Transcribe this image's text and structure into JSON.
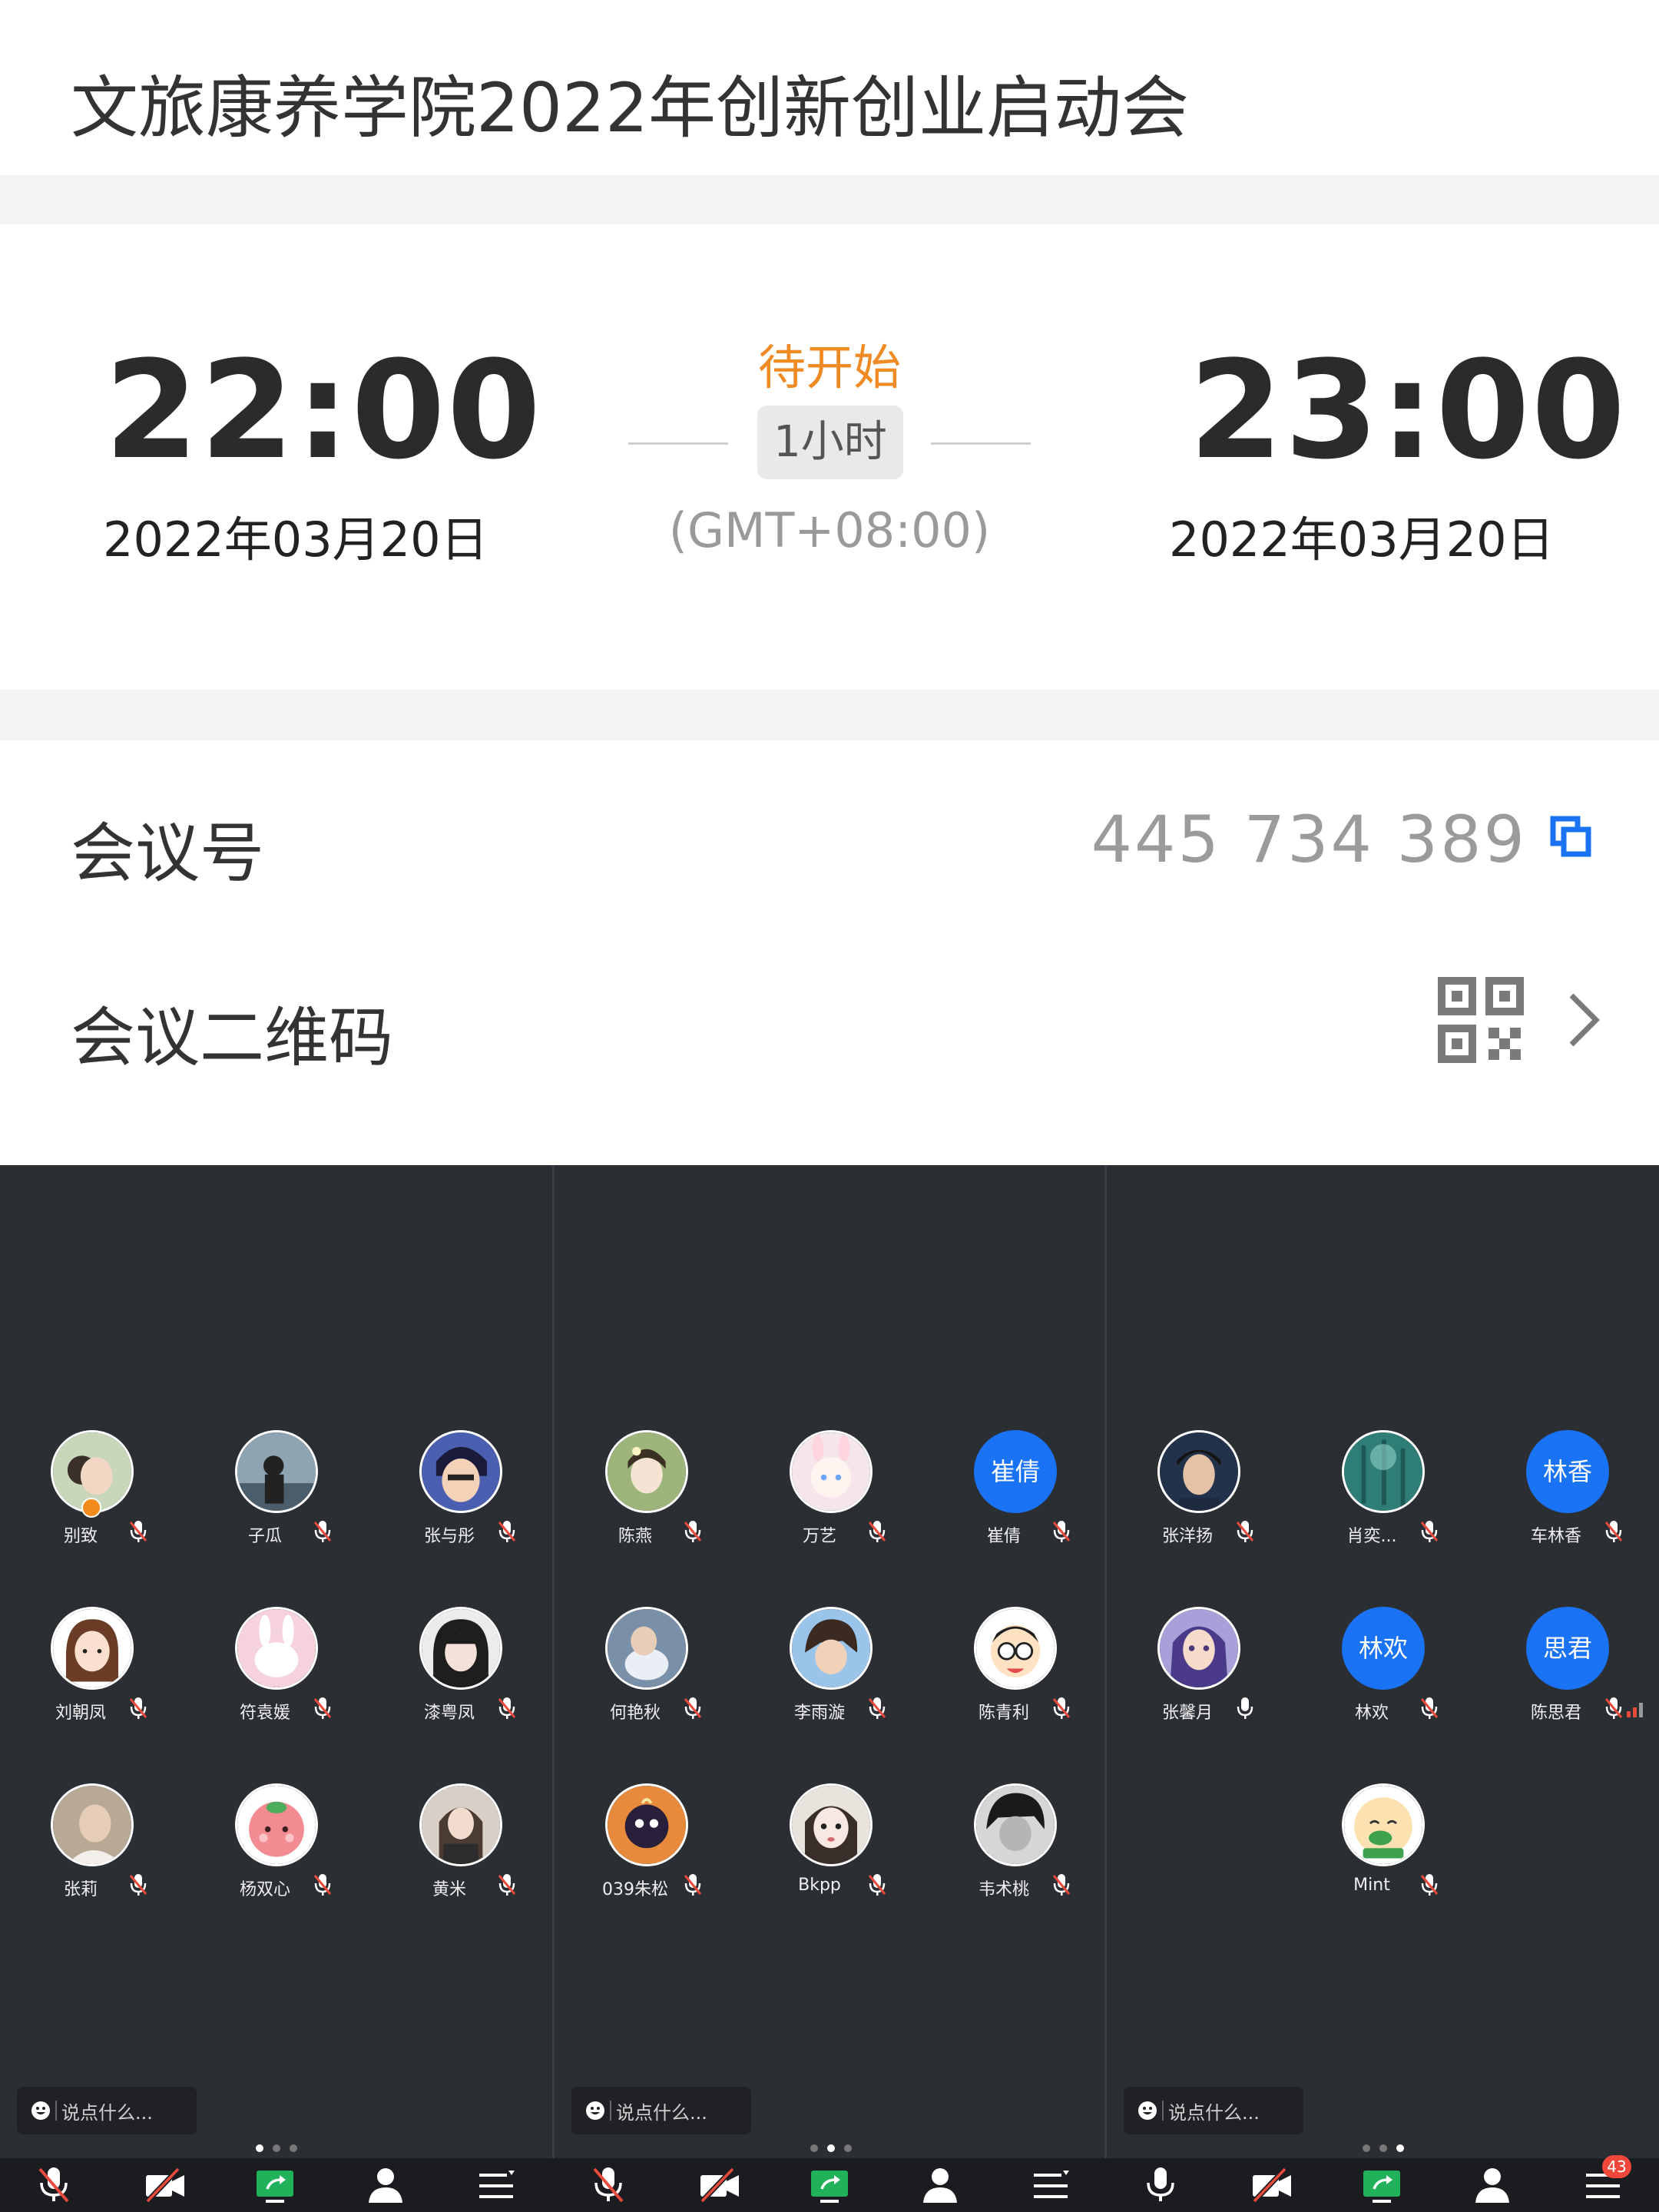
{
  "meeting": {
    "title": "文旅康养学院2022年创新创业启动会",
    "start_time": "22:00",
    "start_date": "2022年03月20日",
    "status": "待开始",
    "duration": "1小时",
    "timezone": "(GMT+08:00)",
    "end_time": "23:00",
    "end_date": "2022年03月20日",
    "id_label": "会议号",
    "id_value": "445 734 389",
    "qr_label": "会议二维码"
  },
  "panels": [
    {
      "participants": [
        {
          "name": "别致",
          "avatar": "photo-girl",
          "host": true
        },
        {
          "name": "子瓜",
          "avatar": "photo-silhouette"
        },
        {
          "name": "张与彤",
          "avatar": "anime-man"
        },
        {
          "name": "刘朝凤",
          "avatar": "cartoon-girl"
        },
        {
          "name": "符袁媛",
          "avatar": "pink-bunny"
        },
        {
          "name": "漆粤凤",
          "avatar": "girl-bangs"
        },
        {
          "name": "张莉",
          "avatar": "photo-portrait"
        },
        {
          "name": "杨双心",
          "avatar": "peach-face"
        },
        {
          "name": "黄米",
          "avatar": "photo-girl-2"
        }
      ],
      "chat_placeholder": "说点什么...",
      "active_dot": 0
    },
    {
      "participants": [
        {
          "name": "陈燕",
          "avatar": "flower-girl"
        },
        {
          "name": "万艺",
          "avatar": "anime-bunny-girl"
        },
        {
          "name": "崔倩",
          "avatar_text": "崔倩"
        },
        {
          "name": "何艳秋",
          "avatar": "girl-cat"
        },
        {
          "name": "李雨漩",
          "avatar": "anime-boy"
        },
        {
          "name": "陈青利",
          "avatar": "nobita"
        },
        {
          "name": "039朱松",
          "avatar": "anime-cat"
        },
        {
          "name": "Bkpp",
          "avatar": "pale-girl"
        },
        {
          "name": "韦术桃",
          "avatar": "bw-boy"
        }
      ],
      "chat_placeholder": "说点什么...",
      "active_dot": 1
    },
    {
      "participants": [
        {
          "name": "张洋扬",
          "avatar": "photo-young-man"
        },
        {
          "name": "肖奕...",
          "avatar": "forest"
        },
        {
          "name": "车林香",
          "avatar_text": "林香"
        },
        {
          "name": "张馨月",
          "avatar": "painted-girl"
        },
        {
          "name": "林欢",
          "avatar_text": "林欢"
        },
        {
          "name": "陈思君",
          "avatar_text": "思君"
        },
        {
          "name": "Mint",
          "avatar": "sleepy-cartoon"
        }
      ],
      "chat_placeholder": "说点什么...",
      "active_dot": 2,
      "message_count": "43"
    }
  ],
  "colors": {
    "status_orange": "#f08a24",
    "accent_blue": "#1a72f5",
    "panel_bg": "#2b2e33",
    "toolbar_bg": "#1a1c1f",
    "share_green": "#21b15a",
    "mute_red": "#e84a3c"
  },
  "toolbar_icons": [
    "mic-muted-icon",
    "video-off-icon",
    "share-screen-icon",
    "participants-icon",
    "more-menu-icon"
  ]
}
